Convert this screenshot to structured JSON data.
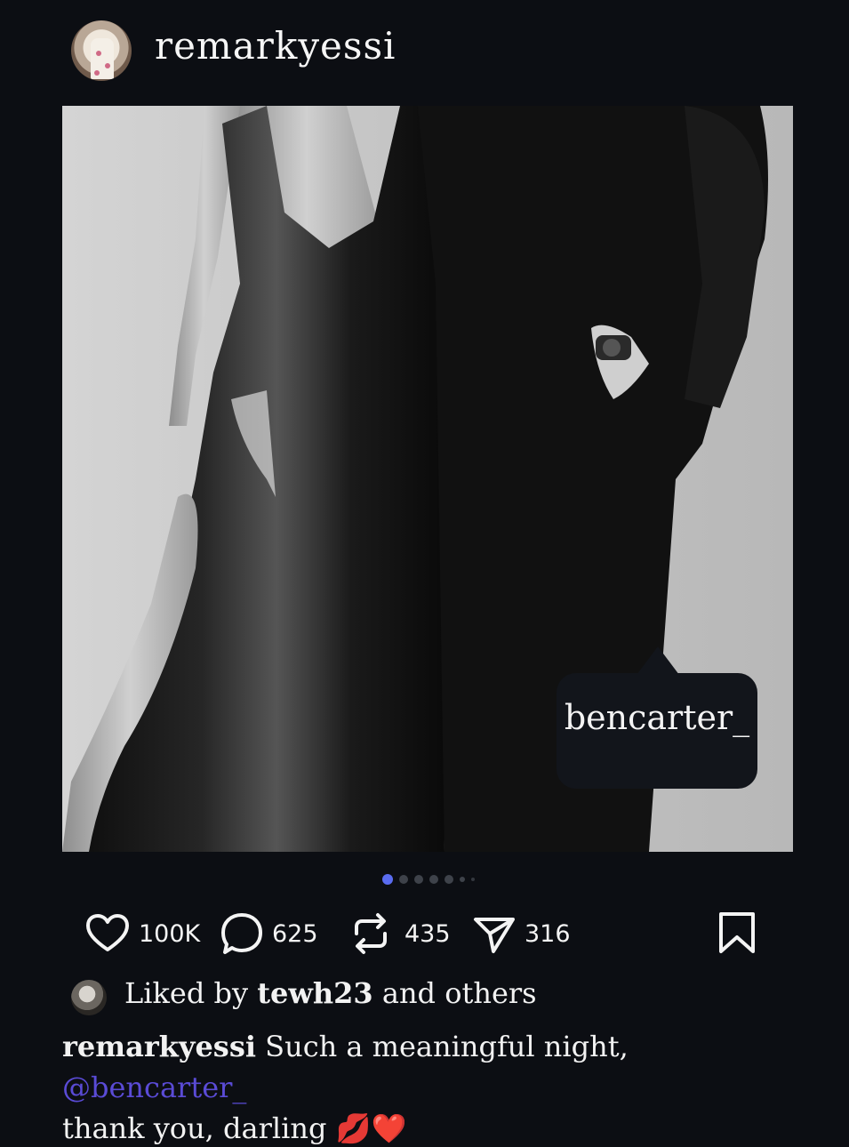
{
  "post": {
    "author": "remarkyessi",
    "tag_label": "bencarter_",
    "pager": {
      "count": 7,
      "active_index": 0
    }
  },
  "actions": {
    "likes": "100K",
    "comments": "625",
    "reposts": "435",
    "shares": "316"
  },
  "liked_by": {
    "prefix": "Liked by",
    "user": "tewh23",
    "suffix": "and others"
  },
  "caption": {
    "author": "remarkyessi",
    "text": "Such a meaningful night,",
    "mention": "@bencarter_",
    "text2": "thank you, darling",
    "emojis": "💋❤️"
  },
  "icons": [
    "heart-icon",
    "comment-icon",
    "repost-icon",
    "share-icon",
    "bookmark-icon"
  ],
  "colors": {
    "background": "#0c0e13",
    "accent": "#5a6cf0",
    "mention": "#5a4bd6"
  }
}
